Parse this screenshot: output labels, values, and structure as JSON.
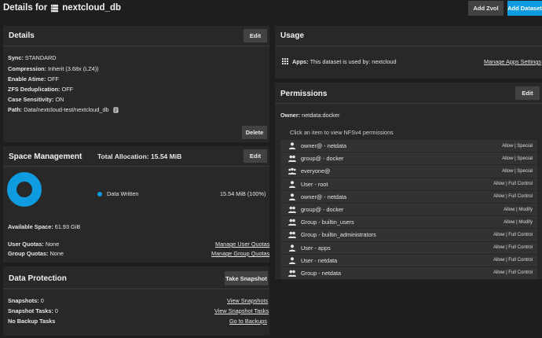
{
  "header": {
    "title_prefix": "Details for",
    "dataset_name": "nextcloud_db",
    "add_zvol_label": "Add Zvol",
    "add_dataset_label": "Add Dataset"
  },
  "details": {
    "title": "Details",
    "edit_label": "Edit",
    "delete_label": "Delete",
    "rows": [
      {
        "key": "Sync:",
        "value": "STANDARD"
      },
      {
        "key": "Compression:",
        "value": "Inherit (3.68x (LZ4))"
      },
      {
        "key": "Enable Atime:",
        "value": "OFF"
      },
      {
        "key": "ZFS Deduplication:",
        "value": "OFF"
      },
      {
        "key": "Case Sensitivity:",
        "value": "ON"
      },
      {
        "key": "Path:",
        "value": "Data/nextcloud-test/nextcloud_db"
      }
    ]
  },
  "space": {
    "title": "Space Management",
    "edit_label": "Edit",
    "total_label": "Total Allocation:",
    "total_value": "15.54 MiB",
    "legend_label": "Data Written",
    "legend_value": "15.54 MiB (100%)",
    "available_key": "Available Space:",
    "available_value": "61.93 GiB",
    "user_quotas_key": "User Quotas:",
    "user_quotas_value": "None",
    "user_quotas_link": "Manage User Quotas",
    "group_quotas_key": "Group Quotas:",
    "group_quotas_value": "None",
    "group_quotas_link": "Manage Group Quotas",
    "accent": "#0e9be0"
  },
  "protection": {
    "title": "Data Protection",
    "take_snapshot_label": "Take Snapshot",
    "snapshots_key": "Snapshots:",
    "snapshots_value": "0",
    "snapshots_link": "View Snapshots",
    "tasks_key": "Snapshot Tasks:",
    "tasks_value": "0",
    "tasks_link": "View Snapshot Tasks",
    "backup_key": "No Backup Tasks",
    "backup_link": "Go to Backups"
  },
  "usage": {
    "title": "Usage",
    "apps_key": "Apps:",
    "apps_value": "This dataset is used by: nextcloud",
    "manage_link": "Manage Apps Settings"
  },
  "permissions": {
    "title": "Permissions",
    "edit_label": "Edit",
    "owner_key": "Owner:",
    "owner_value": "netdata:docker",
    "hint": "Click an item to view NFSv4 permissions",
    "items": [
      {
        "icon": "user-icon",
        "label": "owner@ - netdata",
        "value": "Allow | Special"
      },
      {
        "icon": "group-icon",
        "label": "group@ - docker",
        "value": "Allow | Special"
      },
      {
        "icon": "everyone-icon",
        "label": "everyone@",
        "value": "Allow | Special"
      },
      {
        "icon": "user-icon",
        "label": "User - root",
        "value": "Allow | Full Control"
      },
      {
        "icon": "user-icon",
        "label": "owner@ - netdata",
        "value": "Allow | Full Control"
      },
      {
        "icon": "group-icon",
        "label": "group@ - docker",
        "value": "Allow | Modify"
      },
      {
        "icon": "group-icon",
        "label": "Group - builtin_users",
        "value": "Allow | Modify"
      },
      {
        "icon": "group-icon",
        "label": "Group - builtin_administrators",
        "value": "Allow | Full Control"
      },
      {
        "icon": "user-icon",
        "label": "User - apps",
        "value": "Allow | Full Control"
      },
      {
        "icon": "user-icon",
        "label": "User - netdata",
        "value": "Allow | Full Control"
      },
      {
        "icon": "group-icon",
        "label": "Group - netdata",
        "value": "Allow | Full Control"
      }
    ]
  }
}
